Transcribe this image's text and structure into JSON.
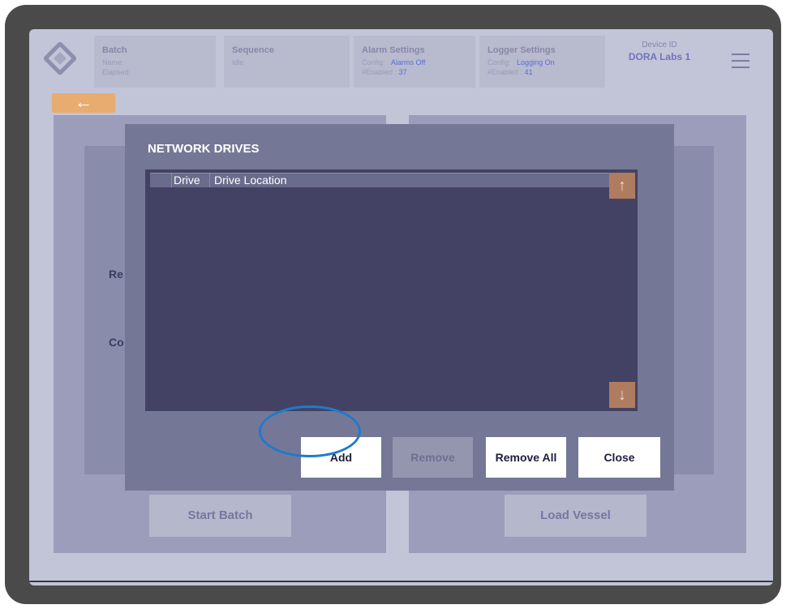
{
  "header": {
    "batch": {
      "title": "Batch",
      "name_label": "Name:",
      "elapsed_label": "Elapsed:"
    },
    "sequence": {
      "title": "Sequence",
      "state": "Idle"
    },
    "alarm": {
      "title": "Alarm Settings",
      "config_label": "Config:",
      "config_value": "Alarms Off",
      "enabled_label": "#Enabled :",
      "enabled_value": "37"
    },
    "logger": {
      "title": "Logger Settings",
      "config_label": "Config:",
      "config_value": "Logging On",
      "enabled_label": "#Enabled :",
      "enabled_value": "41"
    },
    "device": {
      "title": "Device ID",
      "name": "DORA Labs 1"
    }
  },
  "nav": {
    "back_icon": "arrow-left-icon",
    "back_glyph": "←",
    "menu_icon": "hamburger-icon"
  },
  "background": {
    "left_partial_label_1": "Re",
    "left_partial_label_2": "Co",
    "start_batch": "Start Batch",
    "load_vessel": "Load Vessel"
  },
  "modal": {
    "title": "NETWORK DRIVES",
    "columns": [
      "",
      "Drive",
      "Drive Location"
    ],
    "rows": [],
    "scroll_up_glyph": "↑",
    "scroll_down_glyph": "↓",
    "buttons": {
      "add": "Add",
      "remove": "Remove",
      "remove_all": "Remove All",
      "close": "Close"
    }
  },
  "colors": {
    "accent_orange": "#e8ac70",
    "scroll_button": "#b07c60",
    "list_bg": "#434264",
    "highlight": "#1f7acd"
  }
}
